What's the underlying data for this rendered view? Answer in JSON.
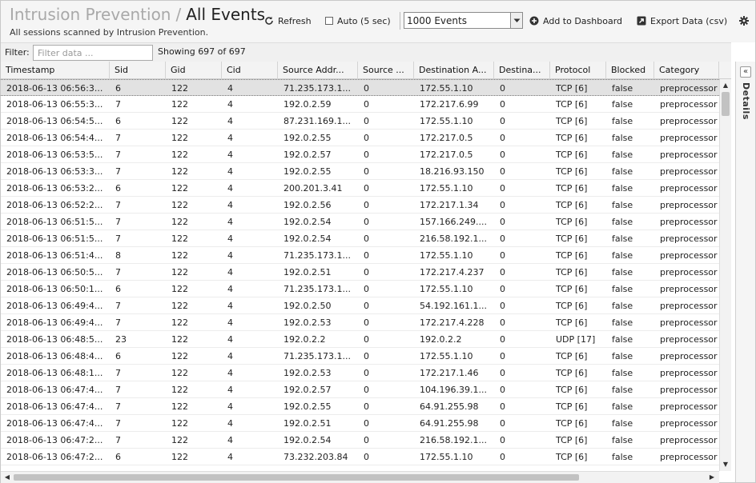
{
  "header": {
    "breadcrumb_parent": "Intrusion Prevention",
    "separator": "/",
    "title": "All Events",
    "subtitle": "All sessions scanned by Intrusion Prevention."
  },
  "toolbar": {
    "refresh_label": "Refresh",
    "auto_label": "Auto (5 sec)",
    "events_select_value": "1000 Events",
    "add_dashboard_label": "Add to Dashboard",
    "export_label": "Export Data (csv)"
  },
  "filter": {
    "label": "Filter:",
    "placeholder": "Filter data ...",
    "showing": "Showing 697 of 697"
  },
  "columns": [
    "Timestamp",
    "Sid",
    "Gid",
    "Cid",
    "Source Addr...",
    "Source ...",
    "Destination A...",
    "Destina...",
    "Protocol",
    "Blocked",
    "Category"
  ],
  "rows": [
    [
      "2018-06-13 06:56:3...",
      "6",
      "122",
      "4",
      "71.235.173.1...",
      "0",
      "172.55.1.10",
      "0",
      "TCP [6]",
      "false",
      "preprocessor"
    ],
    [
      "2018-06-13 06:55:3...",
      "7",
      "122",
      "4",
      "192.0.2.59",
      "0",
      "172.217.6.99",
      "0",
      "TCP [6]",
      "false",
      "preprocessor"
    ],
    [
      "2018-06-13 06:54:5...",
      "6",
      "122",
      "4",
      "87.231.169.1...",
      "0",
      "172.55.1.10",
      "0",
      "TCP [6]",
      "false",
      "preprocessor"
    ],
    [
      "2018-06-13 06:54:4...",
      "7",
      "122",
      "4",
      "192.0.2.55",
      "0",
      "172.217.0.5",
      "0",
      "TCP [6]",
      "false",
      "preprocessor"
    ],
    [
      "2018-06-13 06:53:5...",
      "7",
      "122",
      "4",
      "192.0.2.57",
      "0",
      "172.217.0.5",
      "0",
      "TCP [6]",
      "false",
      "preprocessor"
    ],
    [
      "2018-06-13 06:53:3...",
      "7",
      "122",
      "4",
      "192.0.2.55",
      "0",
      "18.216.93.150",
      "0",
      "TCP [6]",
      "false",
      "preprocessor"
    ],
    [
      "2018-06-13 06:53:2...",
      "6",
      "122",
      "4",
      "200.201.3.41",
      "0",
      "172.55.1.10",
      "0",
      "TCP [6]",
      "false",
      "preprocessor"
    ],
    [
      "2018-06-13 06:52:2...",
      "7",
      "122",
      "4",
      "192.0.2.56",
      "0",
      "172.217.1.34",
      "0",
      "TCP [6]",
      "false",
      "preprocessor"
    ],
    [
      "2018-06-13 06:51:5...",
      "7",
      "122",
      "4",
      "192.0.2.54",
      "0",
      "157.166.249....",
      "0",
      "TCP [6]",
      "false",
      "preprocessor"
    ],
    [
      "2018-06-13 06:51:5...",
      "7",
      "122",
      "4",
      "192.0.2.54",
      "0",
      "216.58.192.1...",
      "0",
      "TCP [6]",
      "false",
      "preprocessor"
    ],
    [
      "2018-06-13 06:51:4...",
      "8",
      "122",
      "4",
      "71.235.173.1...",
      "0",
      "172.55.1.10",
      "0",
      "TCP [6]",
      "false",
      "preprocessor"
    ],
    [
      "2018-06-13 06:50:5...",
      "7",
      "122",
      "4",
      "192.0.2.51",
      "0",
      "172.217.4.237",
      "0",
      "TCP [6]",
      "false",
      "preprocessor"
    ],
    [
      "2018-06-13 06:50:1...",
      "6",
      "122",
      "4",
      "71.235.173.1...",
      "0",
      "172.55.1.10",
      "0",
      "TCP [6]",
      "false",
      "preprocessor"
    ],
    [
      "2018-06-13 06:49:4...",
      "7",
      "122",
      "4",
      "192.0.2.50",
      "0",
      "54.192.161.1...",
      "0",
      "TCP [6]",
      "false",
      "preprocessor"
    ],
    [
      "2018-06-13 06:49:4...",
      "7",
      "122",
      "4",
      "192.0.2.53",
      "0",
      "172.217.4.228",
      "0",
      "TCP [6]",
      "false",
      "preprocessor"
    ],
    [
      "2018-06-13 06:48:5...",
      "23",
      "122",
      "4",
      "192.0.2.2",
      "0",
      "192.0.2.2",
      "0",
      "UDP [17]",
      "false",
      "preprocessor"
    ],
    [
      "2018-06-13 06:48:4...",
      "6",
      "122",
      "4",
      "71.235.173.1...",
      "0",
      "172.55.1.10",
      "0",
      "TCP [6]",
      "false",
      "preprocessor"
    ],
    [
      "2018-06-13 06:48:1...",
      "7",
      "122",
      "4",
      "192.0.2.53",
      "0",
      "172.217.1.46",
      "0",
      "TCP [6]",
      "false",
      "preprocessor"
    ],
    [
      "2018-06-13 06:47:4...",
      "7",
      "122",
      "4",
      "192.0.2.57",
      "0",
      "104.196.39.1...",
      "0",
      "TCP [6]",
      "false",
      "preprocessor"
    ],
    [
      "2018-06-13 06:47:4...",
      "7",
      "122",
      "4",
      "192.0.2.55",
      "0",
      "64.91.255.98",
      "0",
      "TCP [6]",
      "false",
      "preprocessor"
    ],
    [
      "2018-06-13 06:47:4...",
      "7",
      "122",
      "4",
      "192.0.2.51",
      "0",
      "64.91.255.98",
      "0",
      "TCP [6]",
      "false",
      "preprocessor"
    ],
    [
      "2018-06-13 06:47:2...",
      "7",
      "122",
      "4",
      "192.0.2.54",
      "0",
      "216.58.192.1...",
      "0",
      "TCP [6]",
      "false",
      "preprocessor"
    ],
    [
      "2018-06-13 06:47:2...",
      "6",
      "122",
      "4",
      "73.232.203.84",
      "0",
      "172.55.1.10",
      "0",
      "TCP [6]",
      "false",
      "preprocessor"
    ]
  ],
  "selected_row": 0,
  "details_label": "Details",
  "icons": {
    "refresh": "refresh-icon",
    "add_dashboard": "plus-circle-icon",
    "export": "export-icon",
    "settings": "gear-icon",
    "collapse": "double-chevron-left-icon"
  }
}
